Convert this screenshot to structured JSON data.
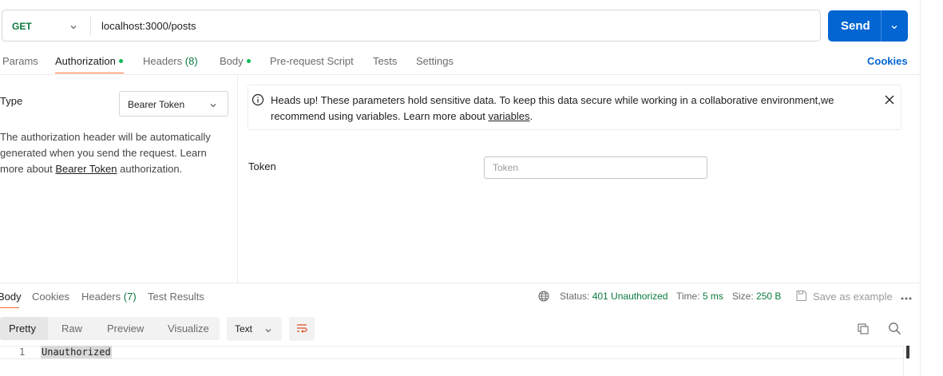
{
  "request": {
    "method": "GET",
    "url": "localhost:3000/posts",
    "send_label": "Send"
  },
  "tabs": [
    {
      "label": "Params"
    },
    {
      "label": "Authorization"
    },
    {
      "label": "Headers",
      "count": "(8)"
    },
    {
      "label": "Body"
    },
    {
      "label": "Pre-request Script"
    },
    {
      "label": "Tests"
    },
    {
      "label": "Settings"
    }
  ],
  "cookies_label": "Cookies",
  "auth": {
    "type_label": "Type",
    "type_value": "Bearer Token",
    "description_pre": "The authorization header will be automatically generated when you send the request. Learn more about",
    "description_link": "Bearer Token",
    "description_post": "authorization."
  },
  "banner": {
    "text": "Heads up! These parameters hold sensitive data. To keep this data secure while working in a collaborative environment,we recommend using variables. Learn more about",
    "link": "variables",
    "suffix": "."
  },
  "token": {
    "label": "Token",
    "placeholder": "Token"
  },
  "response": {
    "tabs": [
      {
        "label": "Body"
      },
      {
        "label": "Cookies"
      },
      {
        "label": "Headers",
        "count": "(7)"
      },
      {
        "label": "Test Results"
      }
    ],
    "status_label": "Status:",
    "status_value": "401 Unauthorized",
    "time_label": "Time:",
    "time_value": "5 ms",
    "size_label": "Size:",
    "size_value": "250 B",
    "save_label": "Save as example",
    "formats": [
      "Pretty",
      "Raw",
      "Preview",
      "Visualize"
    ],
    "text_select": "Text",
    "lines": [
      {
        "no": "1",
        "text": "Unauthorized"
      }
    ]
  },
  "colors": {
    "accent": "#0265d2",
    "method_green": "#0b7a3e",
    "tab_indicator": "#ff6c37",
    "dot_green": "#0cbb52"
  }
}
